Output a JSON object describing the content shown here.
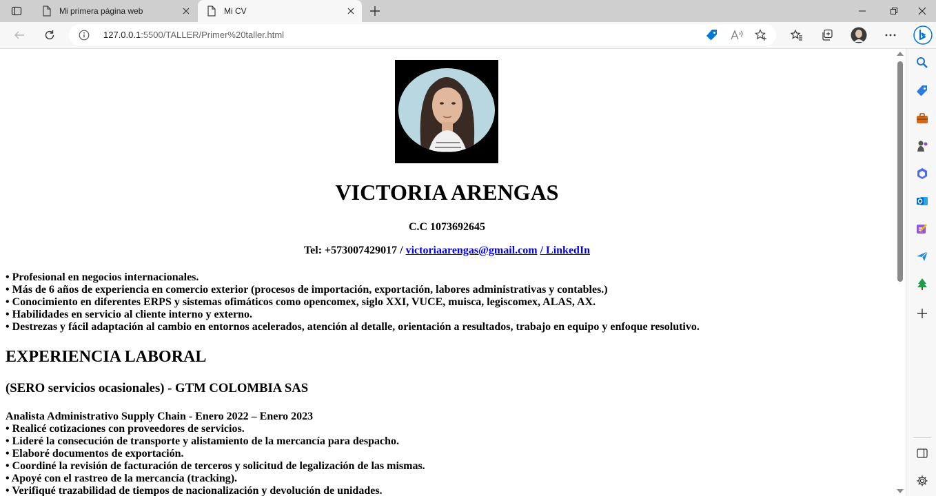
{
  "browser": {
    "tabs": [
      {
        "title": "Mi primera página web",
        "active": false
      },
      {
        "title": "Mi CV",
        "active": true
      }
    ],
    "address": {
      "host": "127.0.0.1",
      "path": ":5500/TALLER/Primer%20taller.html"
    },
    "accent_color": "#0078d4"
  },
  "cv": {
    "name": "VICTORIA ARENGAS",
    "id_line": "C.C 1073692645",
    "contact": {
      "tel": "Tel: +573007429017 /",
      "email": "victoriaarengas@gmail.com",
      "linkedin": "/ LinkedIn"
    },
    "summary": [
      "• Profesional en negocios internacionales.",
      "• Más de 6 años de experiencia en comercio exterior (procesos de importación, exportación, labores administrativas y contables.)",
      "• Conocimiento en diferentes ERPS y sistemas ofimáticos como opencomex, siglo XXI, VUCE, muisca, legiscomex, ALAS, AX.",
      "• Habilidades en servicio al cliente interno y externo.",
      "• Destrezas y fácil adaptación al cambio en entornos acelerados, atención al detalle, orientación a resultados, trabajo en equipo y enfoque resolutivo."
    ],
    "experience_heading": "EXPERIENCIA LABORAL",
    "company": "(SERO servicios ocasionales) - GTM COLOMBIA SAS",
    "role": "Analista Administrativo Supply Chain - Enero 2022 – Enero 2023",
    "duties": [
      "• Realicé cotizaciones con proveedores de servicios.",
      "• Lideré la consecución de transporte y alistamiento de la mercancía para despacho.",
      "• Elaboré documentos de exportación.",
      "• Coordiné la revisión de facturación de terceros y solicitud de legalización de las mismas.",
      "• Apoyé con el rastreo de la mercancía (tracking).",
      "• Verifiqué trazabilidad de tiempos de nacionalización y devolución de unidades."
    ]
  }
}
